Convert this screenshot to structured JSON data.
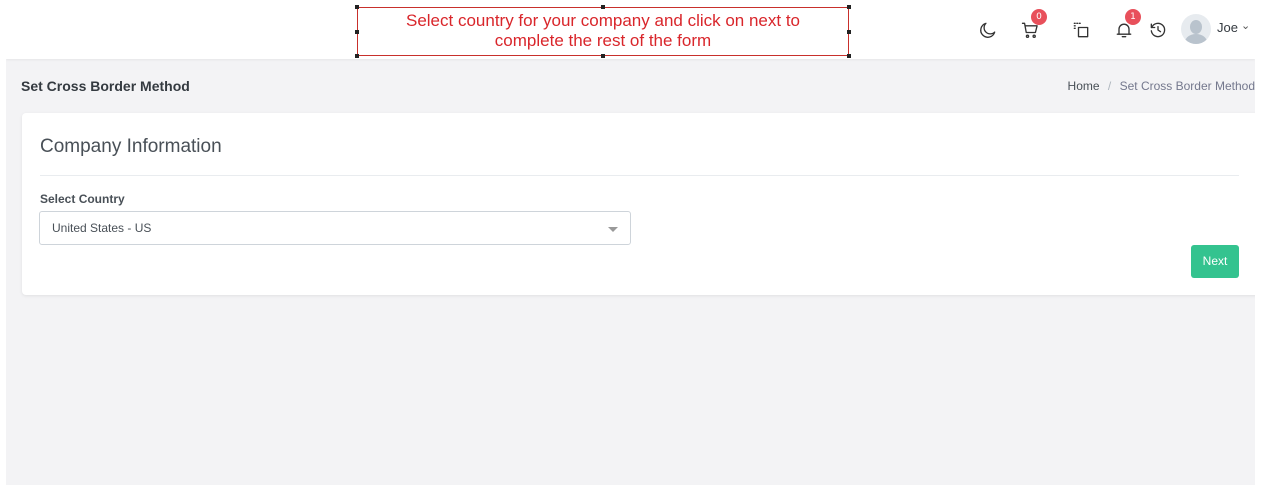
{
  "header": {
    "callout_line1": "Select country for your company and click on next to",
    "callout_line2": "complete the rest of the form",
    "cart_count": "0",
    "notification_count": "1",
    "user_name": "Joe",
    "icons": [
      "moon-icon",
      "cart-icon",
      "apps-icon",
      "bell-icon",
      "history-icon",
      "avatar",
      "chevron-down-icon"
    ]
  },
  "page": {
    "title": "Set Cross Border Method",
    "breadcrumb": {
      "home": "Home",
      "current": "Set Cross Border Method"
    }
  },
  "card": {
    "title": "Company Information",
    "country_label": "Select Country",
    "country_value": "United States - US",
    "next_label": "Next"
  },
  "colors": {
    "accent_green": "#34c38f",
    "badge_red": "#e8505b",
    "callout_red": "#d9262b",
    "page_bg": "#f3f3f5"
  }
}
